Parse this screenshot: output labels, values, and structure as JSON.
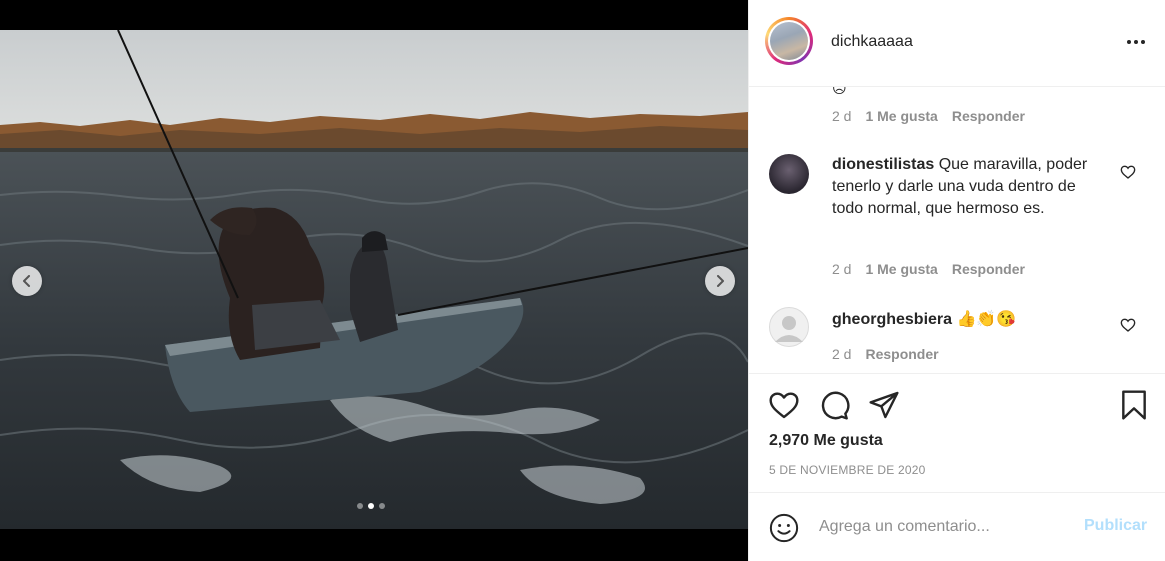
{
  "post": {
    "username": "dichkaaaaa",
    "more_label": "•••",
    "likes_text": "2,970 Me gusta",
    "date_text": "5 DE NOVIEMBRE DE 2020",
    "carousel": {
      "slide_count": 3,
      "active_index": 1
    }
  },
  "comments": {
    "top_meta": {
      "time": "2 d",
      "likes": "1 Me gusta",
      "reply": "Responder"
    },
    "items": [
      {
        "user": "dionestilistas",
        "text": "Que maravilla, poder tenerlo y darle una vuda dentro de todo normal, que hermoso es.",
        "time": "2 d",
        "likes": "1 Me gusta",
        "reply": "Responder"
      },
      {
        "user": "gheorghesbiera",
        "text": "👍👏😘",
        "time": "2 d",
        "reply": "Responder"
      }
    ]
  },
  "add_comment": {
    "placeholder": "Agrega un comentario...",
    "post_label": "Publicar"
  },
  "colors": {
    "accent_disabled": "#b2dffc",
    "muted": "#8e8e8e",
    "text": "#262626",
    "border": "#efefef"
  },
  "icons": [
    "chevron-left-icon",
    "chevron-right-icon",
    "more-icon",
    "heart-icon",
    "comment-icon",
    "share-icon",
    "bookmark-icon",
    "emoji-icon"
  ]
}
